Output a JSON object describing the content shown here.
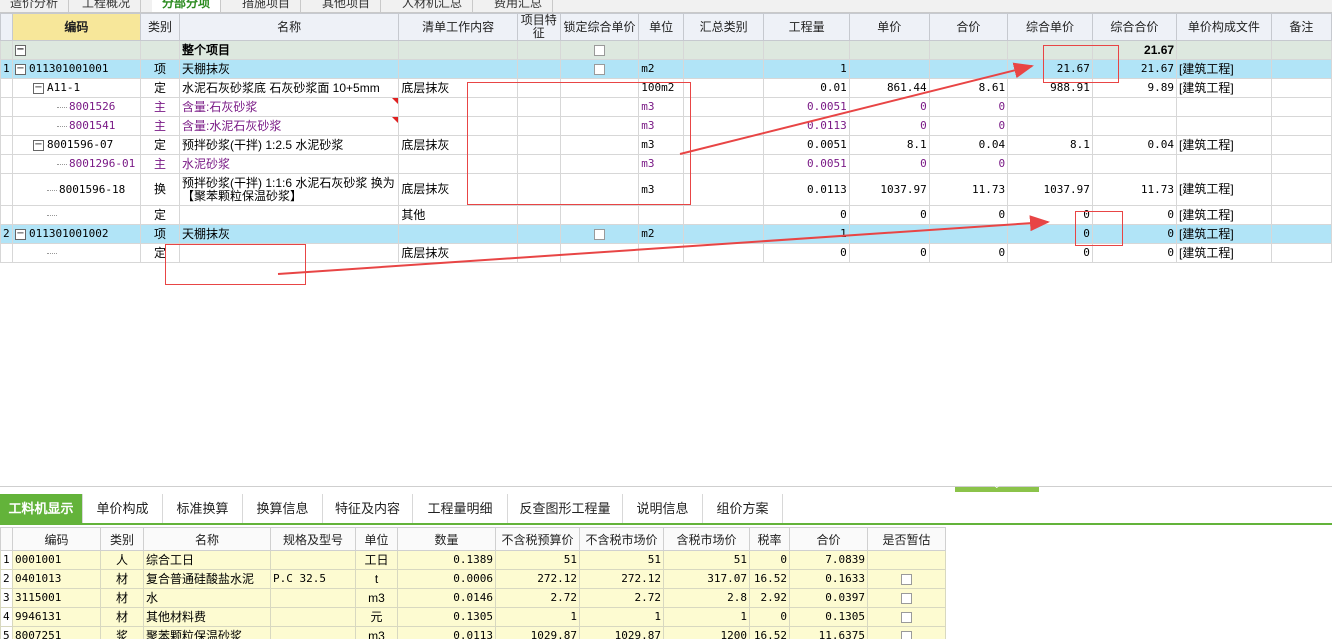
{
  "top_tabs": [
    "造价分析",
    "工程概况",
    "分部分项",
    "措施项目",
    "其他项目",
    "人材机汇总",
    "费用汇总"
  ],
  "main_grid": {
    "headers": {
      "code": "编码",
      "type": "类别",
      "name": "名称",
      "content": "清单工作内容",
      "feature": "项目特征",
      "lock": "锁定综合单价",
      "unit": "单位",
      "summary_type": "汇总类别",
      "qty": "工程量",
      "unit_price": "单价",
      "total_price": "合价",
      "comp_unit_price": "综合单价",
      "comp_total": "综合合价",
      "price_file": "单价构成文件",
      "remark": "备注"
    },
    "top_row": {
      "name": "整个项目",
      "comp_total": "21.67"
    },
    "rows": [
      {
        "rownum": "1",
        "code": "011301001001",
        "type": "项",
        "name": "天棚抹灰",
        "content": "",
        "unit": "m2",
        "qty": "1",
        "unit_price": "",
        "total_price": "",
        "comp_unit_price": "21.67",
        "comp_total": "21.67",
        "price_file": "[建筑工程]"
      },
      {
        "rownum": "",
        "code": "A11-1",
        "type": "定",
        "name": "水泥石灰砂浆底 石灰砂浆面 10+5mm",
        "content": "底层抹灰",
        "unit": "100m2",
        "qty": "0.01",
        "unit_price": "861.44",
        "total_price": "8.61",
        "comp_unit_price": "988.91",
        "comp_total": "9.89",
        "price_file": "[建筑工程]"
      },
      {
        "rownum": "",
        "code": "8001526",
        "type": "主",
        "name": "含量:石灰砂浆",
        "content": "",
        "unit": "m3",
        "qty": "0.0051",
        "unit_price": "0",
        "total_price": "0",
        "comp_unit_price": "",
        "comp_total": "",
        "price_file": ""
      },
      {
        "rownum": "",
        "code": "8001541",
        "type": "主",
        "name": "含量:水泥石灰砂浆",
        "content": "",
        "unit": "m3",
        "qty": "0.0113",
        "unit_price": "0",
        "total_price": "0",
        "comp_unit_price": "",
        "comp_total": "",
        "price_file": ""
      },
      {
        "rownum": "",
        "code": "8001596-07",
        "type": "定",
        "name": "预拌砂浆(干拌) 1:2.5 水泥砂浆",
        "content": "底层抹灰",
        "unit": "m3",
        "qty": "0.0051",
        "unit_price": "8.1",
        "total_price": "0.04",
        "comp_unit_price": "8.1",
        "comp_total": "0.04",
        "price_file": "[建筑工程]"
      },
      {
        "rownum": "",
        "code": "8001296-01",
        "type": "主",
        "name": "水泥砂浆",
        "content": "",
        "unit": "m3",
        "qty": "0.0051",
        "unit_price": "0",
        "total_price": "0",
        "comp_unit_price": "",
        "comp_total": "",
        "price_file": ""
      },
      {
        "rownum": "",
        "code": "8001596-18",
        "type": "换",
        "name": "预拌砂浆(干拌) 1:1:6 水泥石灰砂浆 换为【聚苯颗粒保温砂浆】",
        "content": "底层抹灰",
        "unit": "m3",
        "qty": "0.0113",
        "unit_price": "1037.97",
        "total_price": "11.73",
        "comp_unit_price": "1037.97",
        "comp_total": "11.73",
        "price_file": "[建筑工程]"
      },
      {
        "rownum": "",
        "code": "",
        "type": "定",
        "name": "",
        "content": "其他",
        "unit": "",
        "qty": "0",
        "unit_price": "0",
        "total_price": "0",
        "comp_unit_price": "0",
        "comp_total": "0",
        "price_file": "[建筑工程]"
      },
      {
        "rownum": "2",
        "code": "011301001002",
        "type": "项",
        "name": "天棚抹灰",
        "content": "",
        "unit": "m2",
        "qty": "1",
        "unit_price": "",
        "total_price": "",
        "comp_unit_price": "0",
        "comp_total": "0",
        "price_file": "[建筑工程]"
      },
      {
        "rownum": "",
        "code": "",
        "type": "定",
        "name": "",
        "content": "底层抹灰",
        "unit": "",
        "qty": "0",
        "unit_price": "0",
        "total_price": "0",
        "comp_unit_price": "0",
        "comp_total": "0",
        "price_file": "[建筑工程]"
      }
    ]
  },
  "bottom_tabs": [
    "工料机显示",
    "单价构成",
    "标准换算",
    "换算信息",
    "特征及内容",
    "工程量明细",
    "反查图形工程量",
    "说明信息",
    "组价方案"
  ],
  "bottom_grid": {
    "headers": [
      "编码",
      "类别",
      "名称",
      "规格及型号",
      "单位",
      "数量",
      "不含税预算价",
      "不含税市场价",
      "含税市场价",
      "税率",
      "合价",
      "是否暂估"
    ],
    "rows": [
      {
        "n": "1",
        "code": "0001001",
        "type": "人",
        "name": "综合工日",
        "spec": "",
        "unit": "工日",
        "qty": "0.1389",
        "pre": "51",
        "mkt": "51",
        "tax_mkt": "51",
        "rate": "0",
        "total": "7.0839"
      },
      {
        "n": "2",
        "code": "0401013",
        "type": "材",
        "name": "复合普通硅酸盐水泥",
        "spec": "P.C 32.5",
        "unit": "t",
        "qty": "0.0006",
        "pre": "272.12",
        "mkt": "272.12",
        "tax_mkt": "317.07",
        "rate": "16.52",
        "total": "0.1633"
      },
      {
        "n": "3",
        "code": "3115001",
        "type": "材",
        "name": "水",
        "spec": "",
        "unit": "m3",
        "qty": "0.0146",
        "pre": "2.72",
        "mkt": "2.72",
        "tax_mkt": "2.8",
        "rate": "2.92",
        "total": "0.0397"
      },
      {
        "n": "4",
        "code": "9946131",
        "type": "材",
        "name": "其他材料费",
        "spec": "",
        "unit": "元",
        "qty": "0.1305",
        "pre": "1",
        "mkt": "1",
        "tax_mkt": "1",
        "rate": "0",
        "total": "0.1305"
      },
      {
        "n": "5",
        "code": "8007251",
        "type": "浆",
        "name": "聚苯颗粒保温砂浆",
        "spec": "",
        "unit": "m3",
        "qty": "0.0113",
        "pre": "1029.87",
        "mkt": "1029.87",
        "tax_mkt": "1200",
        "rate": "16.52",
        "total": "11.6375"
      }
    ]
  },
  "colors": {
    "accent": "#63b33a",
    "item_row": "#b1e4f7",
    "annotation": "#e84545"
  }
}
